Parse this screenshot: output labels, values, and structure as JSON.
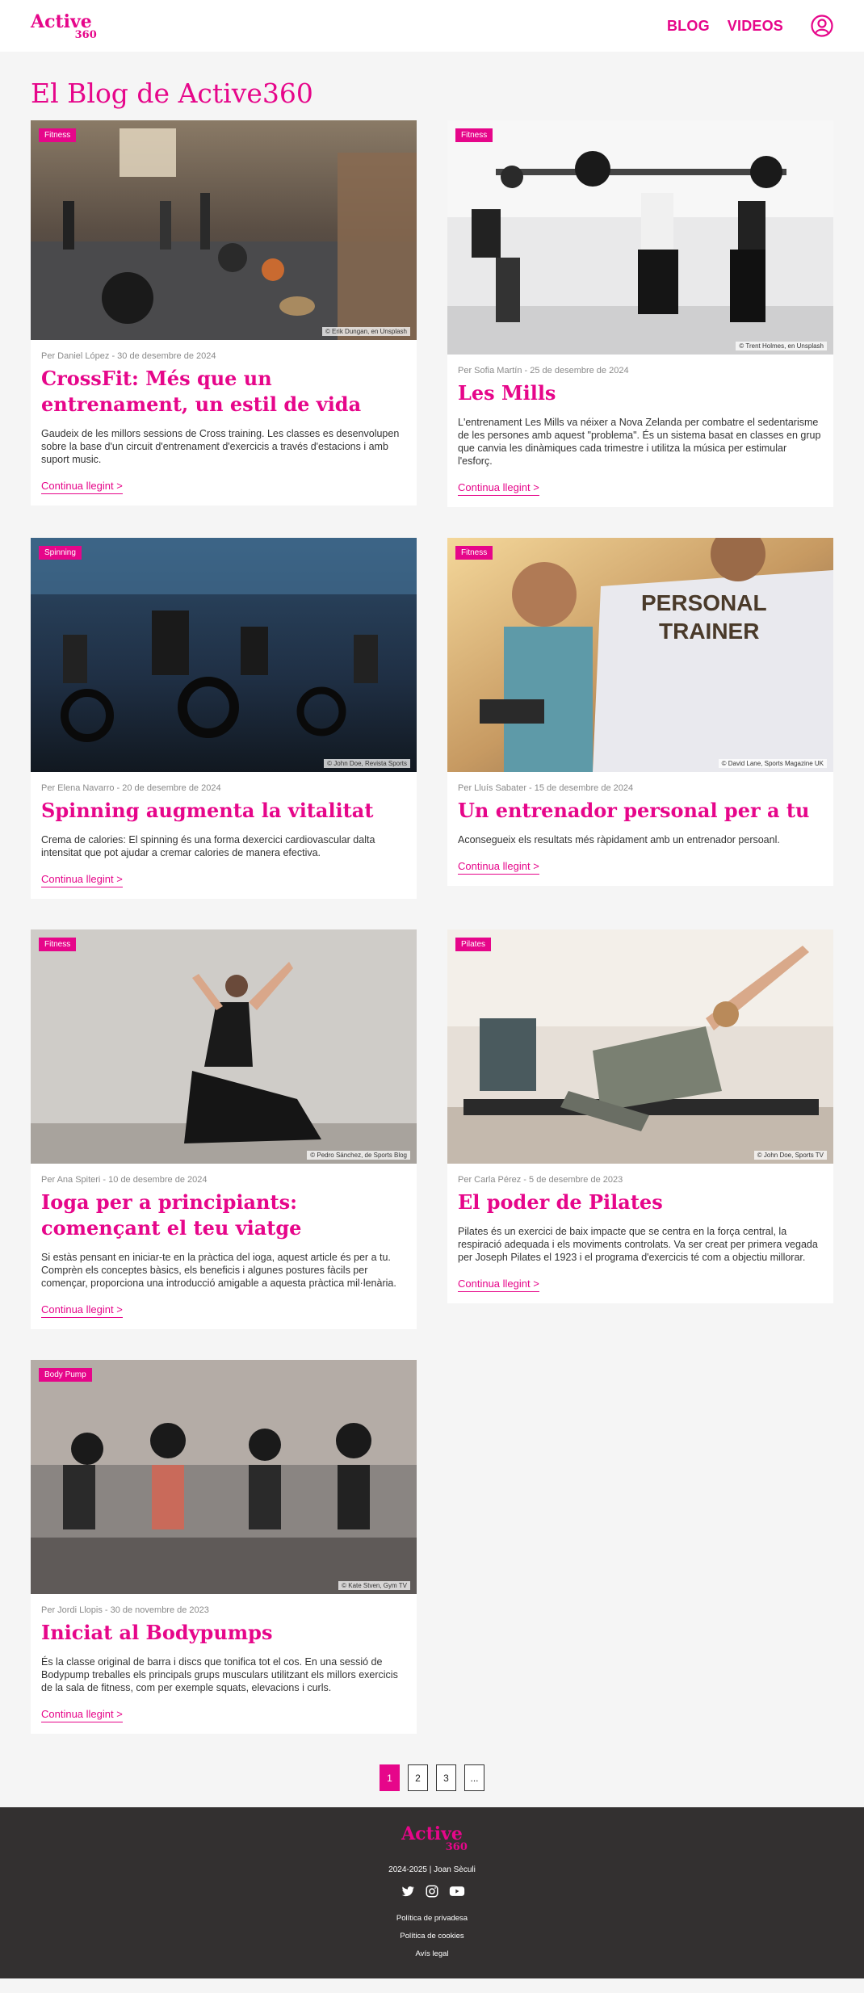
{
  "header": {
    "logo_main": "Active",
    "logo_sub": "360",
    "nav": [
      "BLOG",
      "VIDEOS"
    ]
  },
  "page_title": "El Blog de Active360",
  "posts": [
    {
      "tag": "Fitness",
      "credit": "© Erik Dungan, en Unsplash",
      "meta": "Per Daniel López - 30 de desembre de 2024",
      "title": "CrossFit: Més que un entrenament, un estil de vida",
      "excerpt": "Gaudeix de les millors sessions de Cross training. Les classes es desenvolupen sobre la base d'un circuit d'entrenament d'exercicis a través d'estacions i amb suport music.",
      "more": "Continua llegint >"
    },
    {
      "tag": "Fitness",
      "credit": "© Trent Holmes, en Unsplash",
      "meta": "Per Sofia Martín - 25 de desembre de 2024",
      "title": "Les Mills",
      "excerpt": "L'entrenament Les Mills va néixer a Nova Zelanda per combatre el sedentarisme de les persones amb aquest \"problema\". És un sistema basat en classes en grup que canvia les dinàmiques cada trimestre i utilitza la música per estimular l'esforç.",
      "more": "Continua llegint >"
    },
    {
      "tag": "Spinning",
      "credit": "© John Doe, Revista Sports",
      "meta": "Per Elena Navarro - 20 de desembre de 2024",
      "title": "Spinning augmenta la vitalitat",
      "excerpt": "Crema de calories: El spinning és una forma dexercici cardiovascular dalta intensitat que pot ajudar a cremar calories de manera efectiva.",
      "more": "Continua llegint >"
    },
    {
      "tag": "Fitness",
      "credit": "© David Lane, Sports Magazine UK",
      "meta": "Per Lluís Sabater - 15 de desembre de 2024",
      "title": "Un entrenador personal per a tu",
      "excerpt": "Aconsegueix els resultats més ràpidament amb un entrenador persoanl.",
      "more": "Continua llegint >"
    },
    {
      "tag": "Fitness",
      "credit": "© Pedro Sánchez, de Sports Blog",
      "meta": "Per Ana Spiteri - 10 de desembre de 2024",
      "title": "Ioga per a principiants: començant el teu viatge",
      "excerpt": "Si estàs pensant en iniciar-te en la pràctica del ioga, aquest article és per a tu. Comprèn els conceptes bàsics, els beneficis i algunes postures fàcils per començar, proporciona una introducció amigable a aquesta pràctica mil·lenària.",
      "more": "Continua llegint >"
    },
    {
      "tag": "Pilates",
      "credit": "© John Doe, Sports TV",
      "meta": "Per Carla Pérez - 5 de desembre de 2023",
      "title": "El poder de Pilates",
      "excerpt": "Pilates és un exercici de baix impacte que se centra en la força central, la respiració adequada i els moviments controlats. Va ser creat per primera vegada per Joseph Pilates el 1923 i el programa d'exercicis té com a objectiu millorar.",
      "more": "Continua llegint >"
    },
    {
      "tag": "Body Pump",
      "credit": "© Kate Stven, Gym TV",
      "meta": "Per Jordi Llopis - 30 de novembre de 2023",
      "title": "Iniciat al Bodypumps",
      "excerpt": "És la classe original de barra i discs que tonifica tot el cos. En una sessió de Bodypump treballes els principals grups musculars utilitzant els millors exercicis de la sala de fitness, com per exemple squats, elevacions i curls.",
      "more": "Continua llegint >"
    }
  ],
  "pagination": [
    "1",
    "2",
    "3",
    "..."
  ],
  "pagination_active": "1",
  "footer": {
    "logo_main": "Active",
    "logo_sub": "360",
    "copyright": "2024-2025 | Joan Sèculi",
    "links": [
      "Política de privadesa",
      "Política de cookies",
      "Avís legal"
    ]
  },
  "colors": {
    "accent": "#e6068a",
    "footer_bg": "#333030",
    "page_bg": "#f5f5f5"
  },
  "icons": [
    "user-icon",
    "twitter-icon",
    "instagram-icon",
    "youtube-icon"
  ]
}
